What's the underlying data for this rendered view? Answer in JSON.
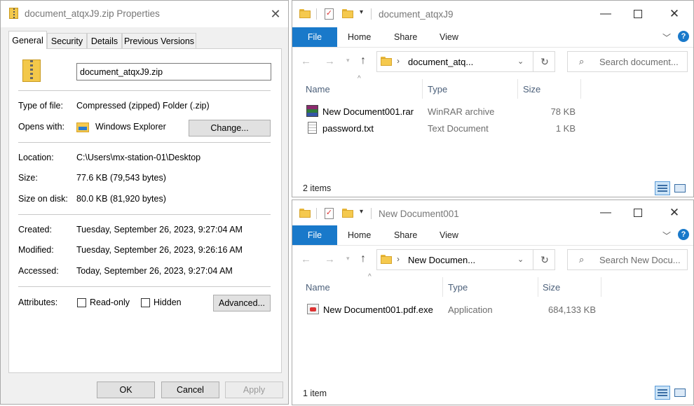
{
  "properties": {
    "title": "document_atqxJ9.zip Properties",
    "tabs": [
      "General",
      "Security",
      "Details",
      "Previous Versions"
    ],
    "filename": "document_atqxJ9.zip",
    "type_label": "Type of file:",
    "type_value": "Compressed (zipped) Folder (.zip)",
    "opens_label": "Opens with:",
    "opens_value": "Windows Explorer",
    "change_label": "Change...",
    "location_label": "Location:",
    "location_value": "C:\\Users\\mx-station-01\\Desktop",
    "size_label": "Size:",
    "size_value": "77.6 KB (79,543 bytes)",
    "sizedisk_label": "Size on disk:",
    "sizedisk_value": "80.0 KB (81,920 bytes)",
    "created_label": "Created:",
    "created_value": "Tuesday, September 26, 2023, 9:27:04 AM",
    "modified_label": "Modified:",
    "modified_value": "Tuesday, September 26, 2023, 9:26:16 AM",
    "accessed_label": "Accessed:",
    "accessed_value": "Today, September 26, 2023, 9:27:04 AM",
    "attributes_label": "Attributes:",
    "readonly_label": "Read-only",
    "hidden_label": "Hidden",
    "advanced_label": "Advanced...",
    "ok_label": "OK",
    "cancel_label": "Cancel",
    "apply_label": "Apply"
  },
  "explorer_top": {
    "title": "document_atqxJ9",
    "ribbon": [
      "File",
      "Home",
      "Share",
      "View"
    ],
    "address": "document_atq...",
    "search_placeholder": "Search document...",
    "columns": [
      "Name",
      "Type",
      "Size"
    ],
    "rows": [
      {
        "name": "New Document001.rar",
        "type": "WinRAR archive",
        "size": "78 KB"
      },
      {
        "name": "password.txt",
        "type": "Text Document",
        "size": "1 KB"
      }
    ],
    "status": "2 items"
  },
  "explorer_bottom": {
    "title": "New Document001",
    "ribbon": [
      "File",
      "Home",
      "Share",
      "View"
    ],
    "address": "New Documen...",
    "search_placeholder": "Search New Docu...",
    "columns": [
      "Name",
      "Type",
      "Size"
    ],
    "rows": [
      {
        "name": "New Document001.pdf.exe",
        "type": "Application",
        "size": "684,133 KB"
      }
    ],
    "status": "1 item"
  },
  "colors": {
    "accent": "#1979ca",
    "help": "#1979ca",
    "folder": "#f5c94e"
  }
}
